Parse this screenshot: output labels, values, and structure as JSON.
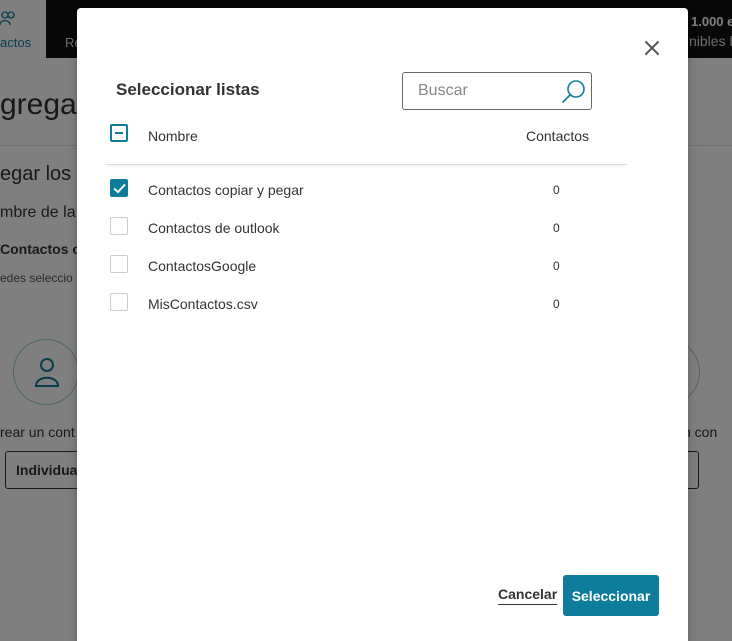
{
  "background": {
    "nav_icon": "contacts-icon",
    "nav_contacts_label": "actos",
    "nav_second_label": "Re",
    "credits_line1": "1.000 e",
    "credits_line2": "nibles h",
    "page_heading": "gregar",
    "section_heading": "egar los",
    "field_label": "mbre de la",
    "subsection_label": "Contactos c",
    "helper_text": "edes seleccio",
    "option_left_caption": "rear un cont",
    "option_right_caption": "n con",
    "individual_button_label": "Individua"
  },
  "modal": {
    "title": "Seleccionar listas",
    "search": {
      "placeholder": "Buscar",
      "value": ""
    },
    "header": {
      "name": "Nombre",
      "count": "Contactos",
      "select_all_state": "mixed"
    },
    "rows": [
      {
        "name": "Contactos copiar y pegar",
        "count": "0",
        "checked": true
      },
      {
        "name": "Contactos de outlook",
        "count": "0",
        "checked": false
      },
      {
        "name": "ContactosGoogle",
        "count": "0",
        "checked": false
      },
      {
        "name": "MisContactos.csv",
        "count": "0",
        "checked": false
      }
    ],
    "cancel_label": "Cancelar",
    "select_label": "Seleccionar"
  },
  "colors": {
    "accent": "#0e7c9b",
    "overlay": "rgba(0,0,0,0.5)",
    "topbar": "#111111"
  }
}
